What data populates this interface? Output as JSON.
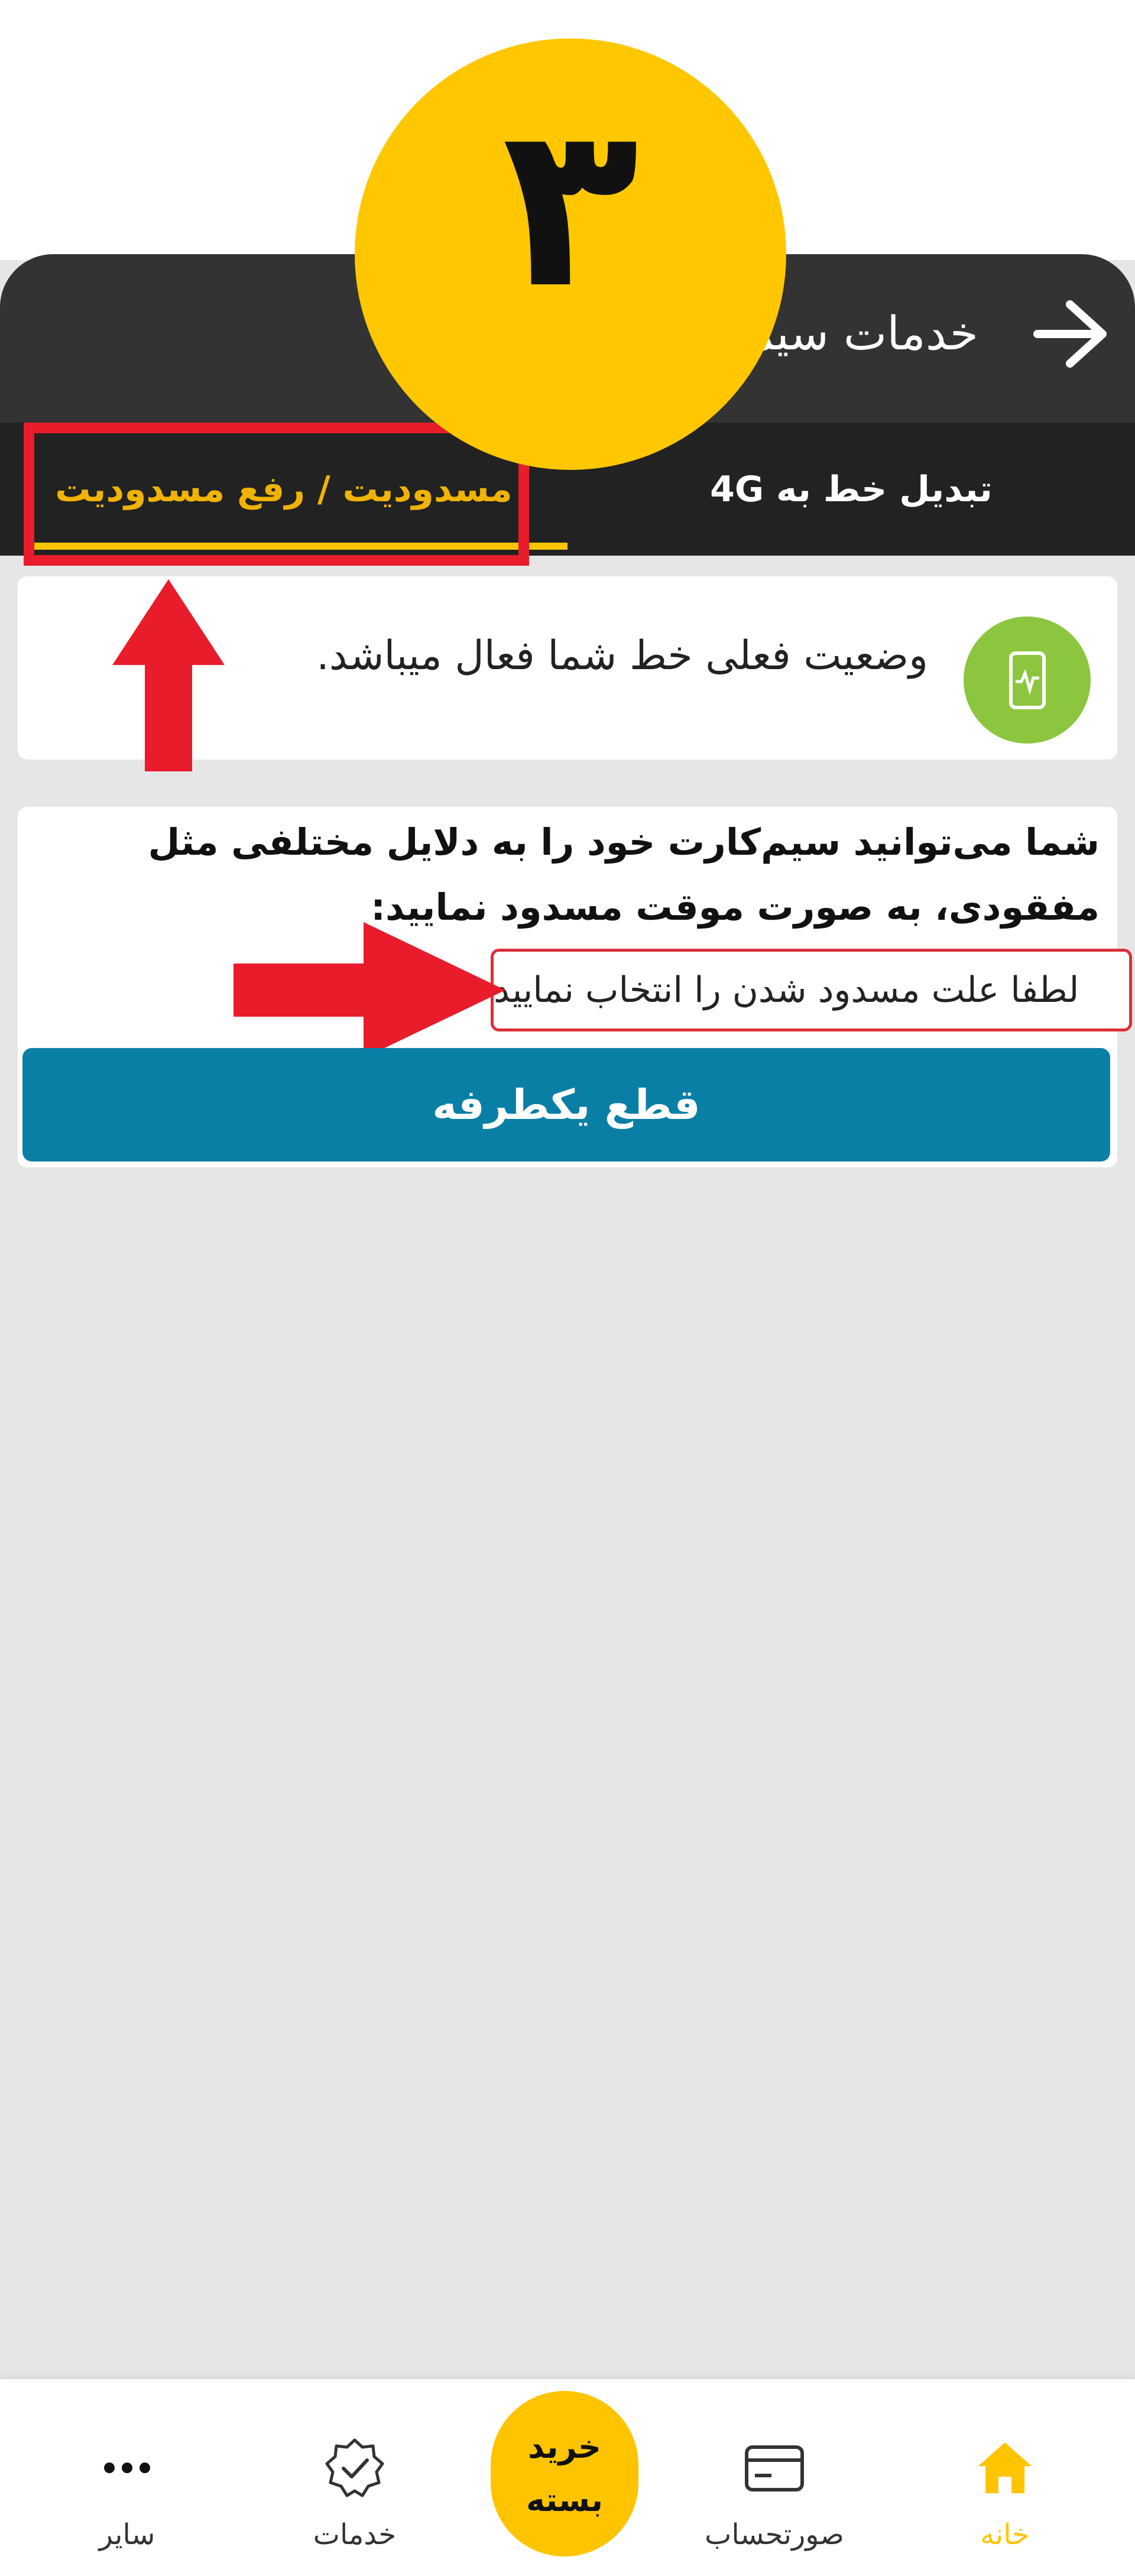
{
  "step_number": "۳",
  "header": {
    "title": "خدمات سیم‌کارت"
  },
  "tabs": [
    {
      "label": "مسدودیت / رفع مسدودیت",
      "active": true
    },
    {
      "label": "تبدیل خط به 4G",
      "active": false
    }
  ],
  "status": {
    "text": "وضعیت فعلی خط شما فعال میباشد."
  },
  "info": {
    "description": "شما می‌توانید سیم‌کارت خود را به دلایل مختلفی مثل مفقودی، به صورت موقت مسدود نمایید:",
    "select_placeholder": "لطفا علت مسدود شدن را انتخاب نمایید"
  },
  "action": {
    "button_label": "قطع یکطرفه"
  },
  "bottom_nav": {
    "home": "خانه",
    "bill": "صورتحساب",
    "buy_line1": "خرید",
    "buy_line2": "بسته",
    "services": "خدمات",
    "more": "سایر"
  },
  "colors": {
    "accent": "#ffc400",
    "header": "#333333",
    "button": "#0a7fa6",
    "annotation": "#e81c2b",
    "status_icon": "#8cc63f"
  }
}
